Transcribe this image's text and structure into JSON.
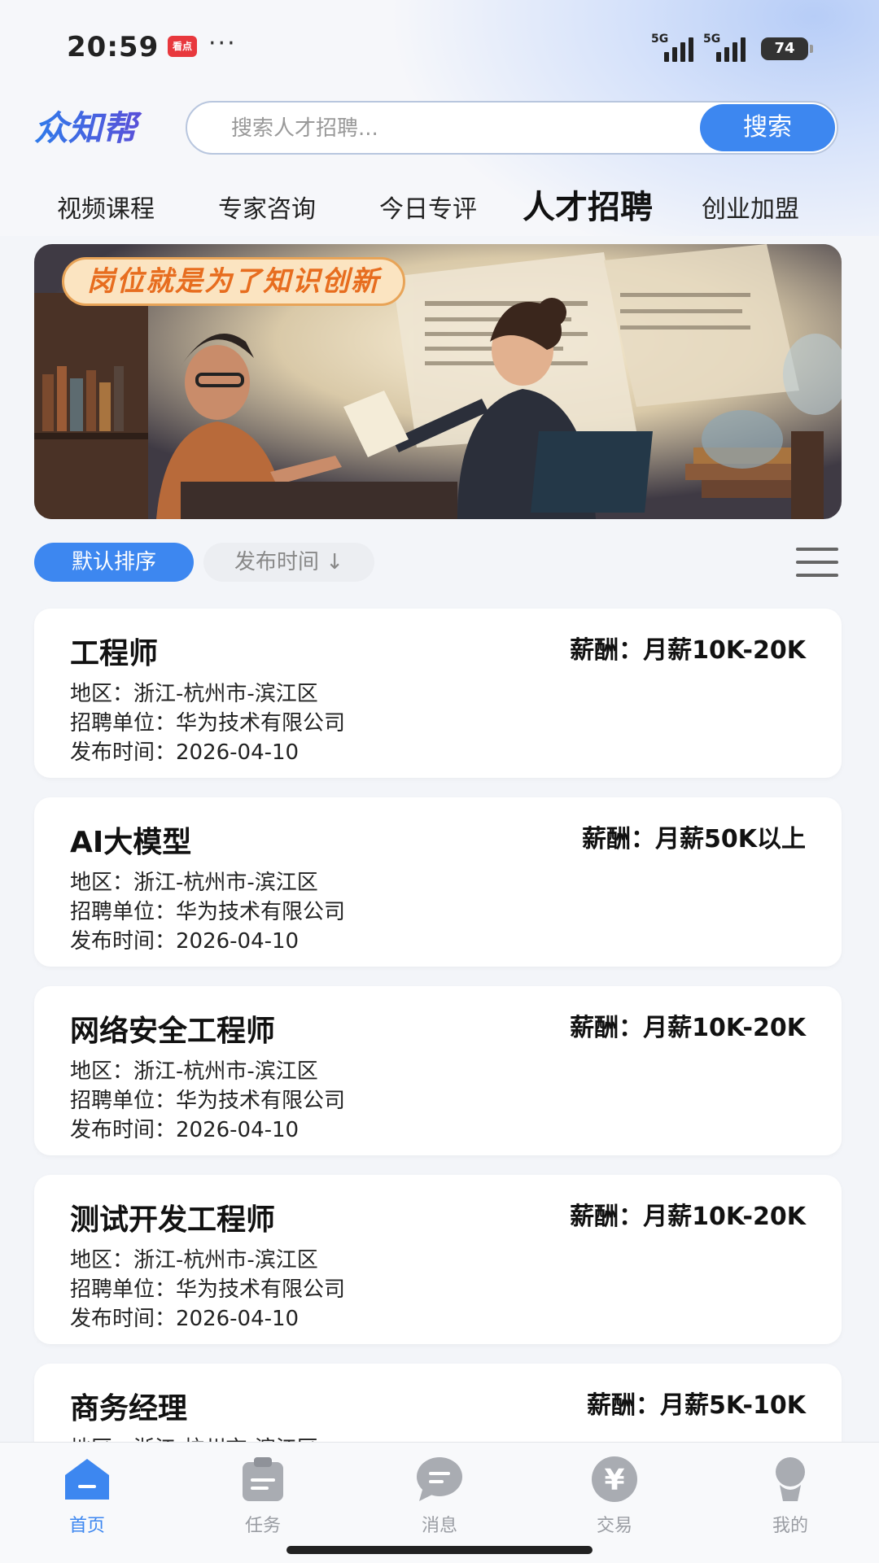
{
  "status_bar": {
    "time": "20:59",
    "app_badge": "看点",
    "more": "···",
    "network1": "5G",
    "network2": "5G",
    "battery": "74"
  },
  "header": {
    "logo_text": "众知帮",
    "search_placeholder": "搜索人才招聘...",
    "search_button": "搜索"
  },
  "nav_tabs": [
    {
      "label": "视频课程",
      "active": false
    },
    {
      "label": "专家咨询",
      "active": false
    },
    {
      "label": "今日专评",
      "active": false
    },
    {
      "label": "人才招聘",
      "active": true
    },
    {
      "label": "创业加盟",
      "active": false
    }
  ],
  "banner": {
    "title": "岗位就是为了知识创新"
  },
  "filters": {
    "default_sort": "默认排序",
    "time_sort": "发布时间 ↓"
  },
  "jobs": [
    {
      "title": "工程师",
      "salary": "薪酬：月薪10K-20K",
      "region": "地区：浙江-杭州市-滨江区",
      "company": "招聘单位：华为技术有限公司",
      "date": "发布时间：2026-04-10"
    },
    {
      "title": "AI大模型",
      "salary": "薪酬：月薪50K以上",
      "region": "地区：浙江-杭州市-滨江区",
      "company": "招聘单位：华为技术有限公司",
      "date": "发布时间：2026-04-10"
    },
    {
      "title": "网络安全工程师",
      "salary": "薪酬：月薪10K-20K",
      "region": "地区：浙江-杭州市-滨江区",
      "company": "招聘单位：华为技术有限公司",
      "date": "发布时间：2026-04-10"
    },
    {
      "title": "测试开发工程师",
      "salary": "薪酬：月薪10K-20K",
      "region": "地区：浙江-杭州市-滨江区",
      "company": "招聘单位：华为技术有限公司",
      "date": "发布时间：2026-04-10"
    },
    {
      "title": "商务经理",
      "salary": "薪酬：月薪5K-10K",
      "region": "地区：浙江-杭州市-滨江区",
      "company": "",
      "date": ""
    }
  ],
  "tabbar": [
    {
      "label": "首页",
      "icon": "home-icon",
      "active": true
    },
    {
      "label": "任务",
      "icon": "clipboard-icon",
      "active": false
    },
    {
      "label": "消息",
      "icon": "chat-icon",
      "active": false
    },
    {
      "label": "交易",
      "icon": "yen-icon",
      "active": false
    },
    {
      "label": "我的",
      "icon": "user-icon",
      "active": false
    }
  ],
  "colors": {
    "accent": "#3d87f0",
    "banner_title": "#e76d1f",
    "inactive": "#9a9da3"
  }
}
